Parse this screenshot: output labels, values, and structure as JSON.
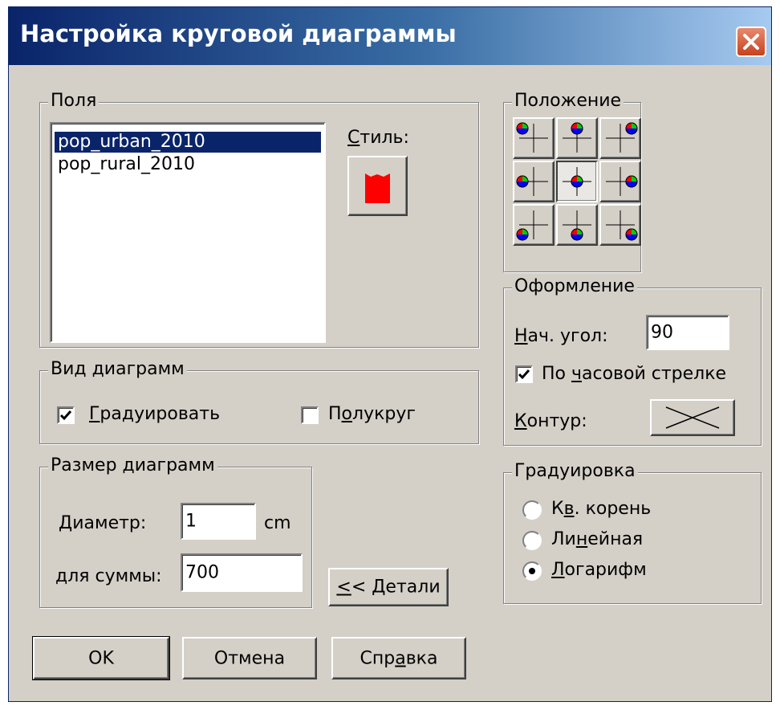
{
  "window": {
    "title": "Настройка круговой диаграммы"
  },
  "fields": {
    "legend": "Поля",
    "items": [
      "pop_urban_2010",
      "pop_rural_2010"
    ],
    "selected_index": 0,
    "style_label": "Стиль:",
    "style_color": "#ff0000"
  },
  "position": {
    "legend": "Положение",
    "selected_index": 4
  },
  "diagram_view": {
    "legend": "Вид диаграмм",
    "graduate_label": "Градуировать",
    "graduate_checked": true,
    "semicircle_label": "Полукруг",
    "semicircle_checked": false
  },
  "design": {
    "legend": "Оформление",
    "start_angle_label": "Нач. угол:",
    "start_angle_value": "90",
    "clockwise_label": "По часовой стрелке",
    "clockwise_checked": true,
    "contour_label": "Контур:"
  },
  "size": {
    "legend": "Размер диаграмм",
    "diameter_label": "Диаметр:",
    "diameter_value": "1",
    "diameter_unit": "cm",
    "sum_label": "для суммы:",
    "sum_value": "700"
  },
  "graduation": {
    "legend": "Градуировка",
    "options": [
      "Кв. корень",
      "Линейная",
      "Логарифм"
    ],
    "selected_index": 2
  },
  "buttons": {
    "details": "<< Детали",
    "ok": "OK",
    "cancel": "Отмена",
    "help": "Справка"
  },
  "colors": {
    "title_start": "#0a246a",
    "title_end": "#a6caf0",
    "face": "#d4d0c8",
    "selection": "#0a246a"
  }
}
